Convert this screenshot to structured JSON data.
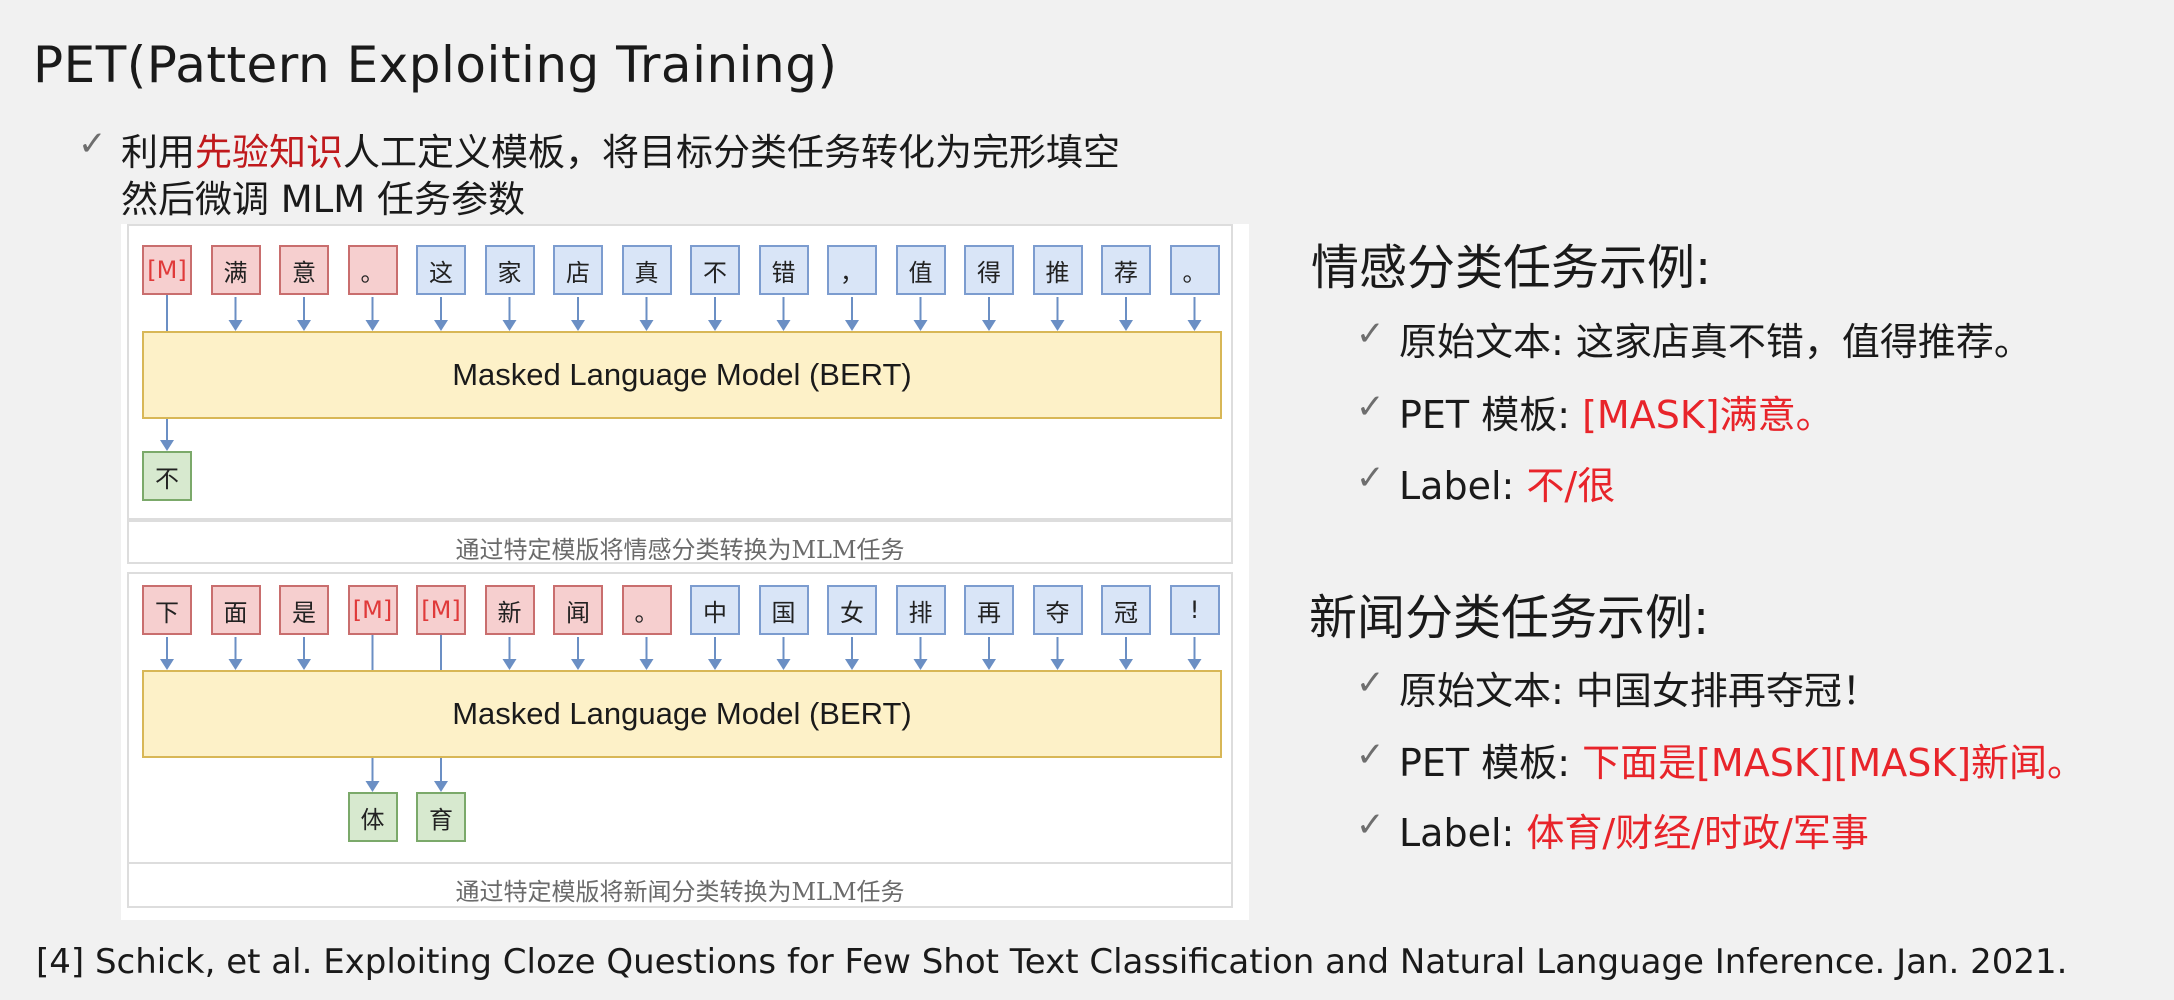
{
  "title": "PET(Pattern Exploiting Training)",
  "bullet": {
    "line1_a": "利用",
    "line1_b": "先验知识",
    "line1_c": "人工定义模板，将目标分类任务转化为完形填空",
    "line2": "然后微调 MLM 任务参数"
  },
  "figure": {
    "panel1": {
      "tokens": [
        "[M]",
        "满",
        "意",
        "。",
        "这",
        "家",
        "店",
        "真",
        "不",
        "错",
        "，",
        "值",
        "得",
        "推",
        "荐",
        "。"
      ],
      "model_label": "Masked Language Model (BERT)",
      "outputs": [
        "不"
      ],
      "caption": "通过特定模版将情感分类转换为MLM任务"
    },
    "panel2": {
      "tokens": [
        "下",
        "面",
        "是",
        "[M]",
        "[M]",
        "新",
        "闻",
        "。",
        "中",
        "国",
        "女",
        "排",
        "再",
        "夺",
        "冠",
        "!"
      ],
      "model_label": "Masked Language Model (BERT)",
      "outputs": [
        "体",
        "育"
      ],
      "caption": "通过特定模版将新闻分类转换为MLM任务"
    }
  },
  "sentiment": {
    "heading": "情感分类任务示例:",
    "original_label": "原始文本: ",
    "original_text": "这家店真不错，值得推荐。",
    "pet_label": "PET 模板: ",
    "pet_value": "[MASK]满意。",
    "label_label": "Label: ",
    "label_value": "不/很"
  },
  "news": {
    "heading": "新闻分类任务示例:",
    "original_label": "原始文本: ",
    "original_text": "中国女排再夺冠！",
    "pet_label": "PET 模板: ",
    "pet_value": "下面是[MASK][MASK]新闻。",
    "label_label": "Label: ",
    "label_value": "体育/财经/时政/军事"
  },
  "check_icon": "✓",
  "reference": "[4] Schick, et al. Exploiting Cloze Questions for Few Shot Text Classification and Natural Language Inference. Jan. 2021."
}
